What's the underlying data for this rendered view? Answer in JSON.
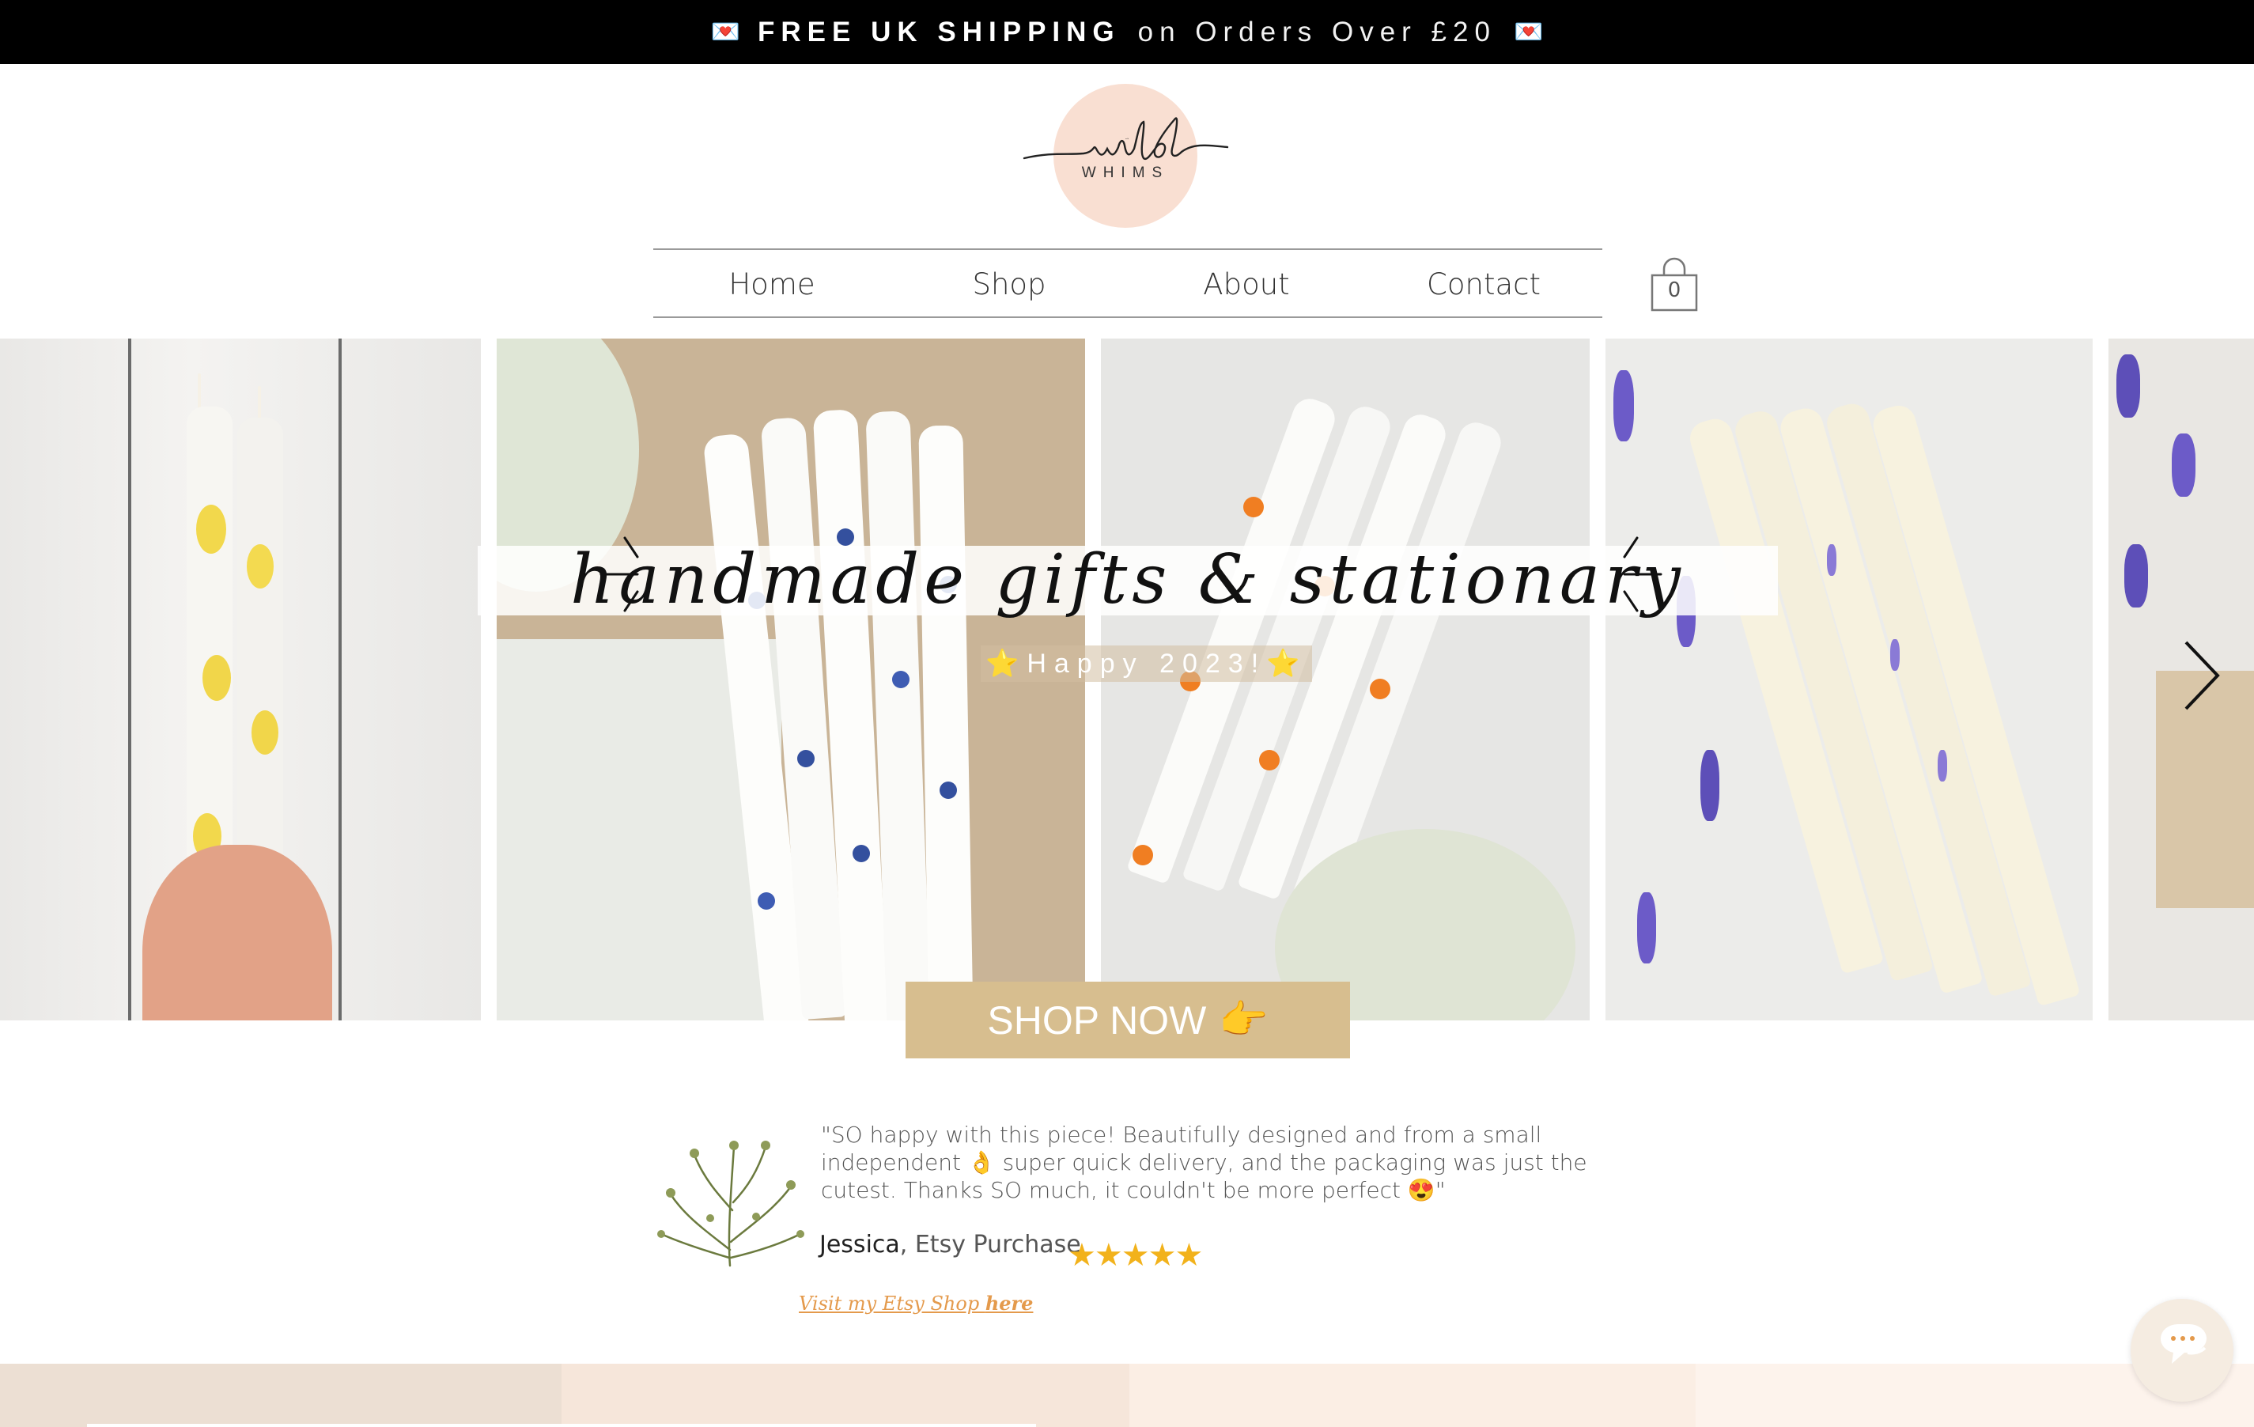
{
  "announcement": {
    "icon_left": "envelope-icon",
    "bold_text": "FREE UK SHIPPING",
    "light_text": "on Orders Over £20",
    "icon_right": "envelope-icon",
    "envelope_glyph": "💌"
  },
  "logo": {
    "script_text": "wild",
    "sub_text": "WHIMS",
    "circle_color": "#f9dfd2"
  },
  "nav": {
    "items": [
      {
        "label": "Home"
      },
      {
        "label": "Shop"
      },
      {
        "label": "About"
      },
      {
        "label": "Contact"
      }
    ],
    "cart_count": "0"
  },
  "hero": {
    "tagline": "handmade gifts & stationary",
    "subtitle": "⭐Happy 2023!⭐",
    "cta_label": "SHOP NOW",
    "cta_icon": "pointing-hand-icon",
    "cta_emoji": "👉",
    "panels": [
      "lemon-candles",
      "blueberry-candles",
      "orange-candles",
      "lavender-candles",
      "lavender-candles-partial"
    ]
  },
  "testimonial": {
    "quote": "\"SO happy with this piece! Beautifully designed and from a small independent 👌 super quick delivery, and the packaging was just the cutest. Thanks SO much, it couldn't be more perfect 😍\"",
    "author": "Jessica",
    "source": ", Etsy Purchase",
    "stars": "★★★★★",
    "rating": 5,
    "link_text": "Visit my Etsy Shop ",
    "link_bold": "here"
  },
  "colors": {
    "accent_cta": "#d7be8f",
    "link": "#e49a4c",
    "stars": "#f2b21b",
    "bands": [
      "#ecdfd3",
      "#f6e6da",
      "#fbeee4",
      "#fdf3ec"
    ]
  }
}
